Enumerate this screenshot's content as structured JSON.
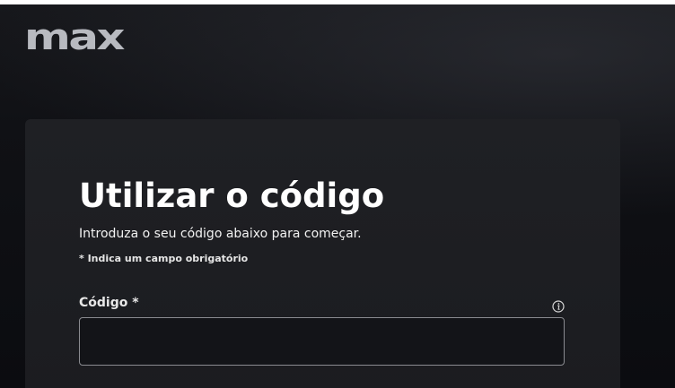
{
  "brand": {
    "logo_text": "max",
    "logo_color": "#b8bac0"
  },
  "card": {
    "title": "Utilizar o código",
    "subtitle": "Introduza o seu código abaixo para começar.",
    "required_note": "* Indica um campo obrigatório"
  },
  "form": {
    "code_field": {
      "label": "Código *",
      "value": "",
      "placeholder": "",
      "info_icon": "info-icon"
    }
  },
  "colors": {
    "background": "#0d0e12",
    "card": "#1e1f23",
    "text": "#ffffff",
    "input_border": "#8a8b90"
  }
}
